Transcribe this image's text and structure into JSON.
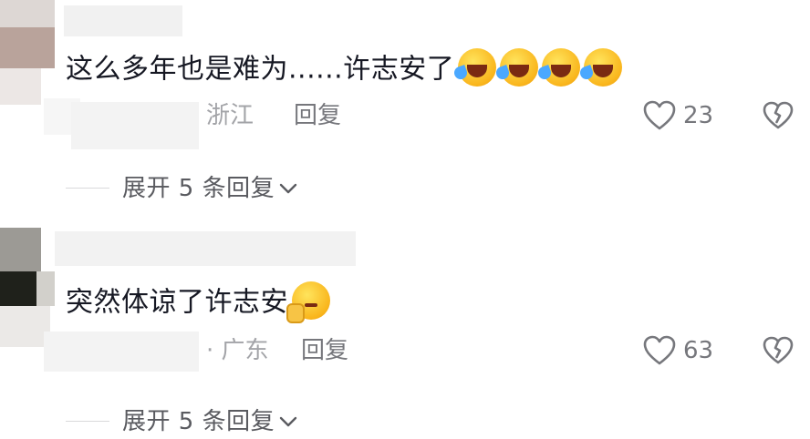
{
  "comments": [
    {
      "text": "这么多年也是难为......许志安了",
      "emoji_icons": [
        "rofl-emoji",
        "rofl-emoji",
        "rofl-emoji",
        "rofl-emoji"
      ],
      "location": "浙江",
      "reply_label": "回复",
      "like_count": "23",
      "expand_label": "展开 5 条回复"
    },
    {
      "text": "突然体谅了许志安",
      "emoji_icons": [
        "thinking-emoji"
      ],
      "location": "· 广东",
      "reply_label": "回复",
      "like_count": "63",
      "expand_label": "展开 5 条回复"
    }
  ],
  "icons": {
    "like": "heart-outline-icon",
    "dislike": "broken-heart-icon",
    "expand": "chevron-down-icon"
  },
  "colors": {
    "text": "#161823",
    "secondary": "#76777c",
    "location": "#a3a4a8",
    "divider": "#d9d9db"
  }
}
